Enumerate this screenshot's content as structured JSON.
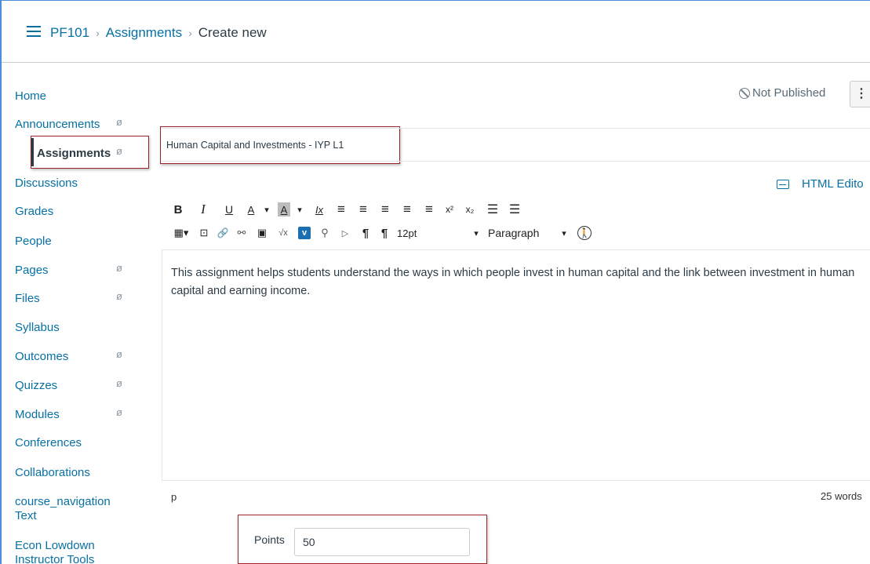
{
  "breadcrumb": {
    "course": "PF101",
    "section": "Assignments",
    "current": "Create new",
    "separator": "›"
  },
  "sidebar": {
    "items": [
      {
        "label": "Home"
      },
      {
        "label": "Announcements"
      },
      {
        "label": "Assignments"
      },
      {
        "label": "Discussions"
      },
      {
        "label": "Grades"
      },
      {
        "label": "People"
      },
      {
        "label": "Pages"
      },
      {
        "label": "Files"
      },
      {
        "label": "Syllabus"
      },
      {
        "label": "Outcomes"
      },
      {
        "label": "Quizzes"
      },
      {
        "label": "Modules"
      },
      {
        "label": "Conferences"
      },
      {
        "label": "Collaborations"
      },
      {
        "label": "course_navigation Text"
      },
      {
        "label": "Econ Lowdown Instructor Tools"
      }
    ],
    "hidden_icon": "eye-slash-icon",
    "hidden_glyph": "ø"
  },
  "status": {
    "published_label": "Not Published",
    "menu_glyph": "⋮"
  },
  "assignment": {
    "title": "Human Capital and Investments - IYP L1"
  },
  "editor": {
    "html_editor_label": "HTML Edito",
    "body": "This assignment helps students understand the ways in which people invest in human capital and the link between investment in human capital and earning income.",
    "element_path": "p",
    "word_count": "25 words",
    "font_size": "12pt",
    "block_format": "Paragraph",
    "toolbar_row1": [
      {
        "name": "bold",
        "glyph": "B"
      },
      {
        "name": "italic",
        "glyph": "I"
      },
      {
        "name": "underline",
        "glyph": "U"
      },
      {
        "name": "text-color",
        "glyph": "A"
      },
      {
        "name": "dropdown",
        "glyph": "▾"
      },
      {
        "name": "bg-color",
        "glyph": "A"
      },
      {
        "name": "dropdown",
        "glyph": "▾"
      },
      {
        "name": "clear-formatting",
        "glyph": "Ix"
      },
      {
        "name": "align-left",
        "glyph": "≡"
      },
      {
        "name": "align-center",
        "glyph": "≡"
      },
      {
        "name": "align-right",
        "glyph": "≡"
      },
      {
        "name": "outdent",
        "glyph": "≡"
      },
      {
        "name": "indent",
        "glyph": "≡"
      },
      {
        "name": "superscript",
        "glyph": "x²"
      },
      {
        "name": "subscript",
        "glyph": "x₂"
      },
      {
        "name": "bullet-list",
        "glyph": "☰"
      },
      {
        "name": "numbered-list",
        "glyph": "☰"
      }
    ],
    "toolbar_row2": [
      {
        "name": "table",
        "glyph": "▦▾"
      },
      {
        "name": "media",
        "glyph": "⊡"
      },
      {
        "name": "link",
        "glyph": "🔗"
      },
      {
        "name": "unlink",
        "glyph": "⚯"
      },
      {
        "name": "image",
        "glyph": "▣"
      },
      {
        "name": "math",
        "glyph": "√x"
      },
      {
        "name": "vimeo",
        "glyph": "v"
      },
      {
        "name": "plugin",
        "glyph": "⚲"
      },
      {
        "name": "embed",
        "glyph": "▷"
      },
      {
        "name": "ltr",
        "glyph": "¶"
      },
      {
        "name": "rtl",
        "glyph": "¶"
      }
    ]
  },
  "points": {
    "label": "Points",
    "value": "50"
  },
  "colors": {
    "link": "#0770a3",
    "highlight_box": "#9b2228",
    "text": "#2d3b45"
  }
}
